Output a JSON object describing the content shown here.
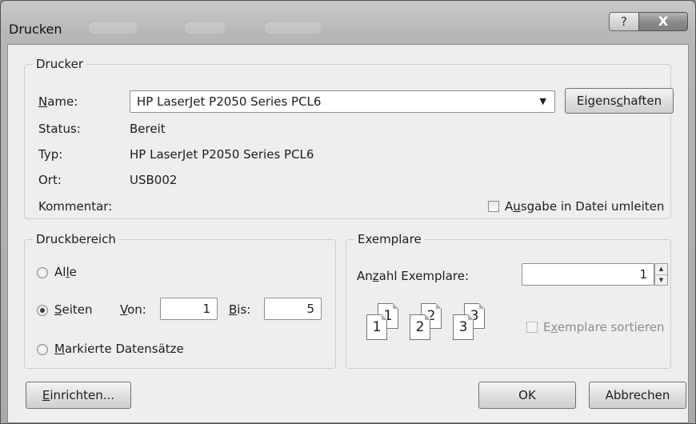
{
  "window": {
    "title": "Drucken",
    "help_label": "?",
    "close_label": "X"
  },
  "printer": {
    "group_label": "Drucker",
    "name_label": "Name:",
    "name_value": "HP LaserJet P2050 Series PCL6",
    "properties_button": "Eigenschaften",
    "status_label": "Status:",
    "status_value": "Bereit",
    "type_label": "Typ:",
    "type_value": "HP LaserJet P2050 Series PCL6",
    "location_label": "Ort:",
    "location_value": "USB002",
    "comment_label": "Kommentar:",
    "print_to_file_label": "Ausgabe in Datei umleiten",
    "print_to_file_checked": false
  },
  "print_range": {
    "group_label": "Druckbereich",
    "all_label": "Alle",
    "pages_label": "Seiten",
    "from_label": "Von:",
    "from_value": "1",
    "to_label": "Bis:",
    "to_value": "5",
    "selection_label": "Markierte Datensätze",
    "selected": "pages"
  },
  "copies": {
    "group_label": "Exemplare",
    "count_label": "Anzahl Exemplare:",
    "count_value": "1",
    "collate_label": "Exemplare sortieren",
    "collate_checked": false,
    "collate_enabled": false,
    "illustration_numbers": [
      "1",
      "1",
      "2",
      "2",
      "3",
      "3"
    ]
  },
  "footer": {
    "setup_button": "Einrichten...",
    "ok_button": "OK",
    "cancel_button": "Abbrechen"
  },
  "icons": [
    "help-icon",
    "close-icon",
    "dropdown-arrow-icon",
    "spin-up-icon",
    "spin-down-icon",
    "copies-collate-icon"
  ]
}
